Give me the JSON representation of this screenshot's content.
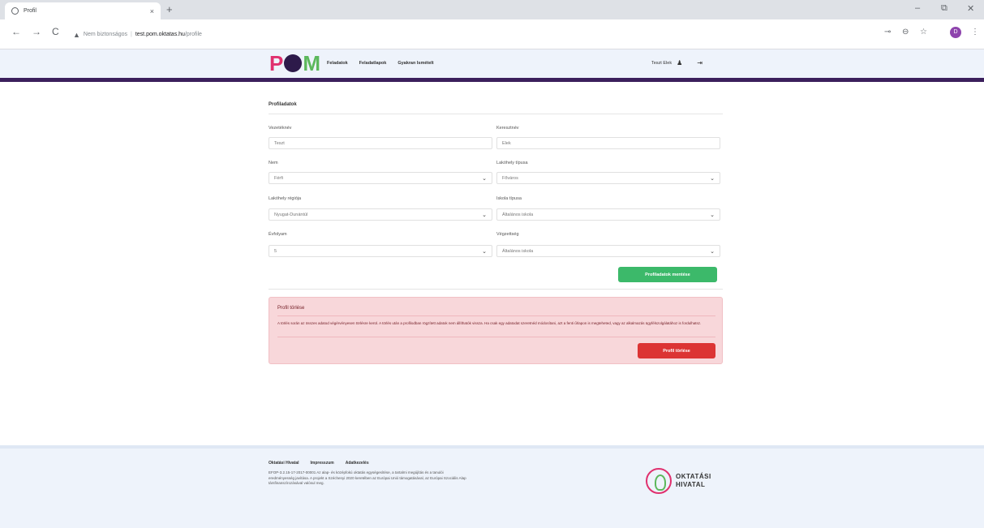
{
  "browser": {
    "tab_title": "Profil",
    "tab_close": "×",
    "new_tab": "+",
    "minimize": "–",
    "restore": "⧉",
    "close": "✕",
    "back": "←",
    "forward": "→",
    "reload": "C",
    "security_state": "Nem biztonságos",
    "url_sep": "|",
    "url_host": "test.pom.oktatas.hu",
    "url_path": "/profile",
    "avatar_letter": "D"
  },
  "header": {
    "logo_letters": [
      "P",
      "M"
    ],
    "nav": [
      "Feladatok",
      "Feladatlapok",
      "Gyakran Ismételt"
    ],
    "user_name": "Teszt Elek"
  },
  "profile": {
    "title": "Profiladatok",
    "fields": {
      "lastname": {
        "label": "Vezetéknév",
        "value": "Teszt"
      },
      "firstname": {
        "label": "Keresztnév",
        "value": "Elek"
      },
      "gender": {
        "label": "Nem",
        "value": "Férfi"
      },
      "settlement_type": {
        "label": "Lakóhely típusa",
        "value": "Főváros"
      },
      "region": {
        "label": "Lakóhely régiója",
        "value": "Nyugat-Dunántúl"
      },
      "school_type": {
        "label": "Iskola típusa",
        "value": "Általános iskola"
      },
      "grade": {
        "label": "Évfolyam",
        "value": "5"
      },
      "role": {
        "label": "Végzettség",
        "value": "Általános iskola"
      }
    },
    "save_label": "Profiladatok mentése"
  },
  "delete_alert": {
    "title": "Profil törlése",
    "text": "A törlés során az összes adatod végérvényesen törlésre kerül. A törlés után a profilodban rögzített adatok nem állíthatók vissza. Ha csak egy adatodat szeretnéd módosítani, azt a fenti űrlapon is megteheted, vagy az alkalmazás ügyfélszolgálatához is fordulhatsz.",
    "delete_label": "Profil törlése"
  },
  "footer": {
    "links": [
      "Oktatási Hivatal",
      "Impresszum",
      "Adatkezelés"
    ],
    "text": "EFOP-3.2.15-17-2017-00001 Az alap- és középfokú oktatás egységesítése, a tartalmi megújítás és a tanulói eredményesség javítása. A projekt a Széchenyi 2020 keretében az Európai Unió támogatásával, az Európai Szociális Alap társfinanszírozásával valósul meg.",
    "brand_line1": "OKTATÁSI",
    "brand_line2": "HIVATAL"
  },
  "colors": {
    "accent_purple": "#3b1f5c",
    "save_green": "#3cb96a",
    "delete_red": "#dc3434",
    "alert_bg": "#f8d7da"
  }
}
